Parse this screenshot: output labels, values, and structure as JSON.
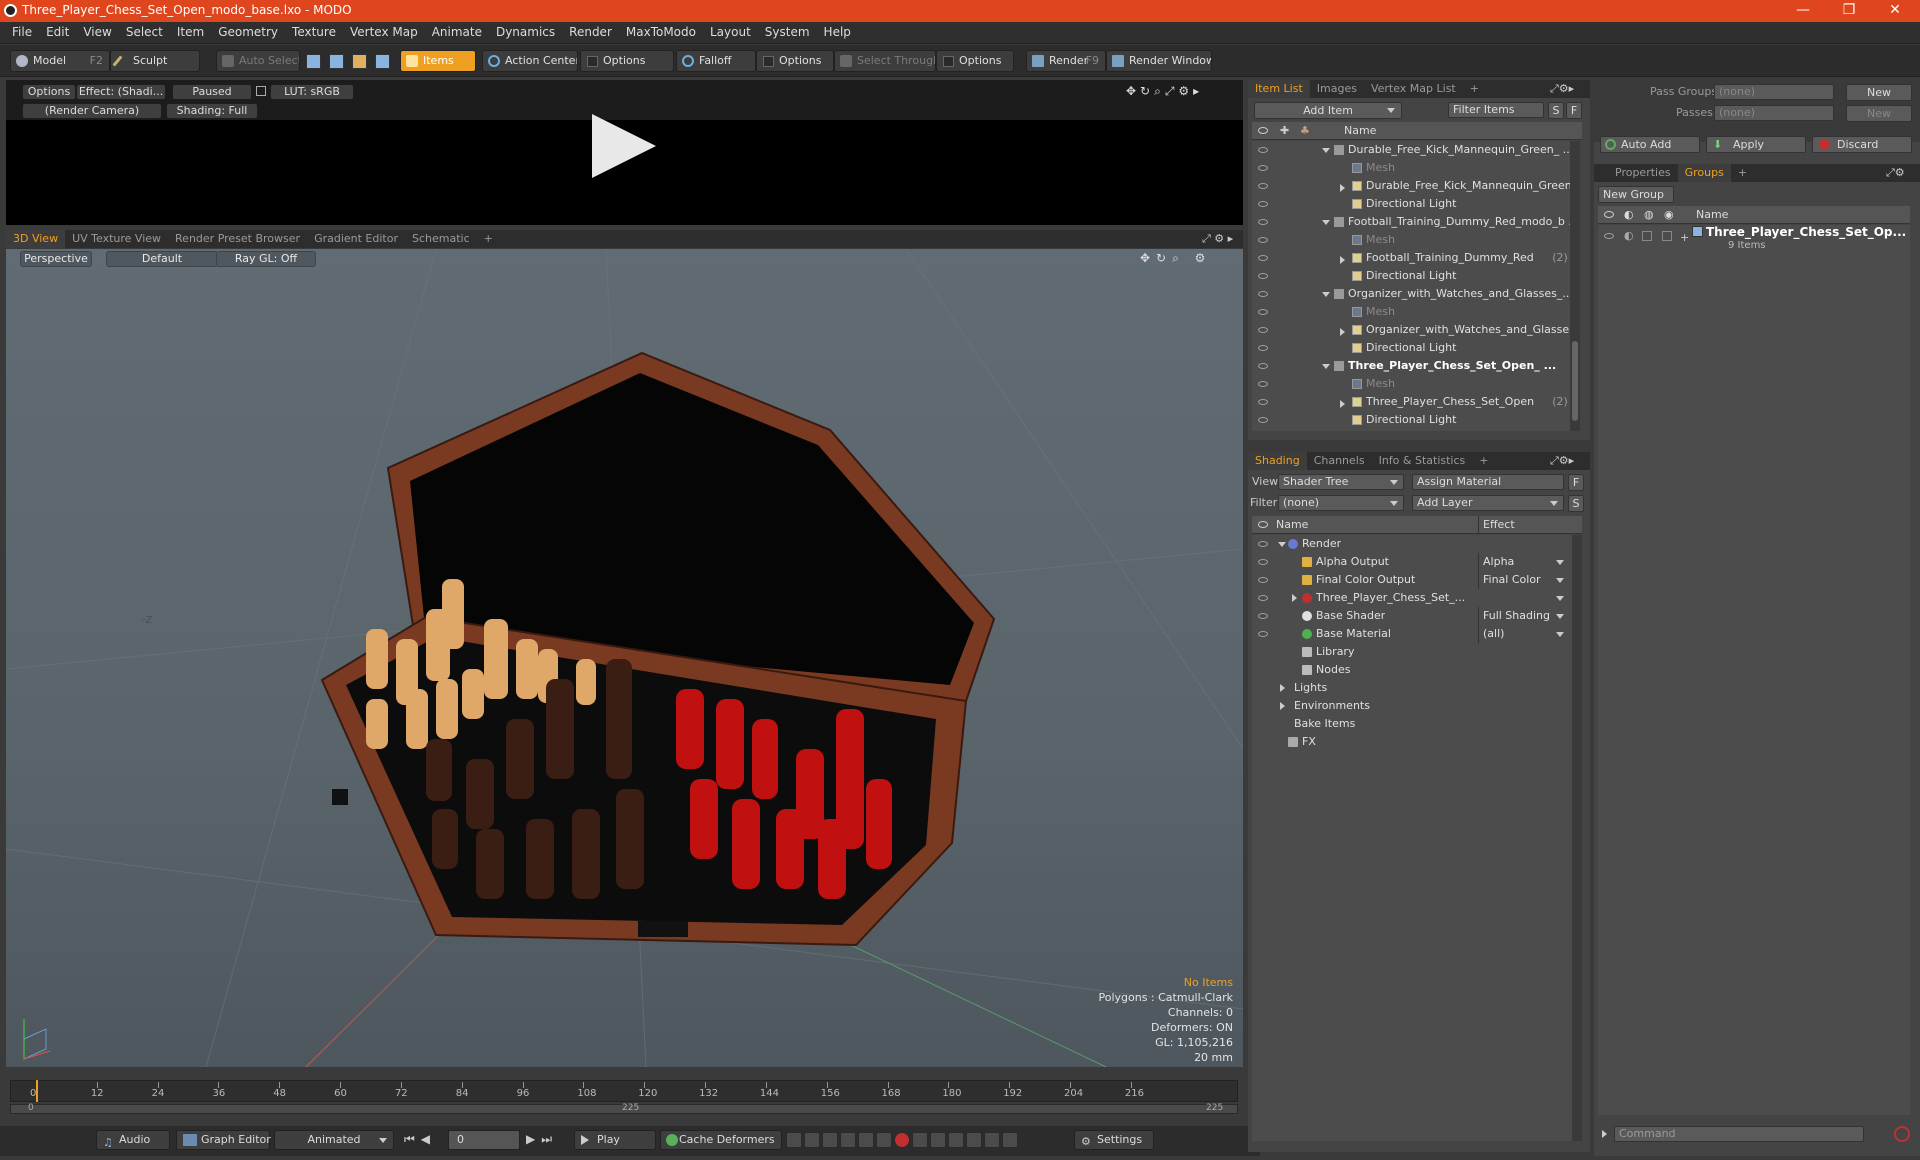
{
  "window": {
    "title": "Three_Player_Chess_Set_Open_modo_base.lxo - MODO",
    "minimize": "—",
    "restore": "❐",
    "close": "✕"
  },
  "menu": [
    "File",
    "Edit",
    "View",
    "Select",
    "Item",
    "Geometry",
    "Texture",
    "Vertex Map",
    "Animate",
    "Dynamics",
    "Render",
    "MaxToModo",
    "Layout",
    "System",
    "Help"
  ],
  "toolbar": {
    "model": "Model",
    "model_key": "F2",
    "sculpt": "Sculpt",
    "auto_select": "Auto Select",
    "items": "Items",
    "action_center": "Action Center",
    "options1": "Options",
    "falloff": "Falloff",
    "options2": "Options",
    "select_through": "Select Through",
    "options3": "Options",
    "render": "Render",
    "render_key": "F9",
    "render_window": "Render Window"
  },
  "preview": {
    "options": "Options",
    "effect": "Effect: (Shadi...",
    "paused": "Paused",
    "lut": "LUT: sRGB",
    "camera": "(Render Camera)",
    "shading": "Shading: Full"
  },
  "viewtabs": [
    "3D View",
    "UV Texture View",
    "Render Preset Browser",
    "Gradient Editor",
    "Schematic",
    "+"
  ],
  "viewport": {
    "perspective": "Perspective",
    "default": "Default",
    "raygl": "Ray GL: Off",
    "axis_label": "-Z",
    "stats": {
      "items": "No Items",
      "polygons": "Polygons : Catmull-Clark",
      "channels": "Channels: 0",
      "deformers": "Deformers: ON",
      "gl": "GL: 1,105,216",
      "scale": "20 mm"
    }
  },
  "timeline": {
    "ticks": [
      "0",
      "12",
      "24",
      "36",
      "48",
      "60",
      "72",
      "84",
      "96",
      "108",
      "120",
      "132",
      "144",
      "156",
      "168",
      "180",
      "192",
      "204",
      "216"
    ],
    "start": "0",
    "mid": "225",
    "end": "225"
  },
  "bottombar": {
    "audio": "Audio",
    "graph_editor": "Graph Editor",
    "animated": "Animated",
    "frame": "0",
    "play": "Play",
    "cache": "Cache Deformers",
    "settings": "Settings"
  },
  "itemlist": {
    "tabs": [
      "Item List",
      "Images",
      "Vertex Map List",
      "+"
    ],
    "add_item": "Add Item",
    "filter": "Filter Items",
    "s": "S",
    "f": "F",
    "col_name": "Name",
    "rows": [
      {
        "label": "Durable_Free_Kick_Mannequin_Green_ ...",
        "indent": 0,
        "style": "scene",
        "expand": "down"
      },
      {
        "label": "Mesh",
        "indent": 1,
        "style": "dim",
        "expand": ""
      },
      {
        "label": "Durable_Free_Kick_Mannequin_Green...",
        "indent": 1,
        "style": "",
        "expand": "right"
      },
      {
        "label": "Directional Light",
        "indent": 1,
        "style": "",
        "expand": ""
      },
      {
        "label": "Football_Training_Dummy_Red_modo_b ...",
        "indent": 0,
        "style": "scene",
        "expand": "down"
      },
      {
        "label": "Mesh",
        "indent": 1,
        "style": "dim",
        "expand": ""
      },
      {
        "label": "Football_Training_Dummy_Red",
        "count": "(2)",
        "indent": 1,
        "style": "",
        "expand": "right"
      },
      {
        "label": "Directional Light",
        "indent": 1,
        "style": "",
        "expand": ""
      },
      {
        "label": "Organizer_with_Watches_and_Glasses_...",
        "indent": 0,
        "style": "scene",
        "expand": "down"
      },
      {
        "label": "Mesh",
        "indent": 1,
        "style": "dim",
        "expand": ""
      },
      {
        "label": "Organizer_with_Watches_and_Glasse...",
        "indent": 1,
        "style": "",
        "expand": "right"
      },
      {
        "label": "Directional Light",
        "indent": 1,
        "style": "",
        "expand": ""
      },
      {
        "label": "Three_Player_Chess_Set_Open_ ...",
        "indent": 0,
        "style": "bold",
        "expand": "down"
      },
      {
        "label": "Mesh",
        "indent": 1,
        "style": "dim",
        "expand": ""
      },
      {
        "label": "Three_Player_Chess_Set_Open",
        "count": "(2)",
        "indent": 1,
        "style": "",
        "expand": "right"
      },
      {
        "label": "Directional Light",
        "indent": 1,
        "style": "",
        "expand": ""
      }
    ]
  },
  "shading": {
    "tabs": [
      "Shading",
      "Channels",
      "Info & Statistics",
      "+"
    ],
    "view_label": "View",
    "view_value": "Shader Tree",
    "assign": "Assign Material",
    "f": "F",
    "filter_label": "Filter",
    "filter_value": "(none)",
    "add_layer": "Add Layer",
    "s": "S",
    "col_name": "Name",
    "col_effect": "Effect",
    "rows": [
      {
        "label": "Render",
        "effect": "",
        "indent": 0,
        "icon": "render"
      },
      {
        "label": "Alpha Output",
        "effect": "Alpha",
        "indent": 1,
        "icon": "output"
      },
      {
        "label": "Final Color Output",
        "effect": "Final Color",
        "indent": 1,
        "icon": "output"
      },
      {
        "label": "Three_Player_Chess_Set_...",
        "effect": "",
        "indent": 1,
        "icon": "material"
      },
      {
        "label": "Base Shader",
        "effect": "Full Shading",
        "indent": 1,
        "icon": "shader"
      },
      {
        "label": "Base Material",
        "effect": "(all)",
        "indent": 1,
        "icon": "basemat"
      },
      {
        "label": "Library",
        "effect": "",
        "indent": 1,
        "icon": "folder"
      },
      {
        "label": "Nodes",
        "effect": "",
        "indent": 1,
        "icon": "folder"
      },
      {
        "label": "Lights",
        "effect": "",
        "indent": 0,
        "icon": "none"
      },
      {
        "label": "Environments",
        "effect": "",
        "indent": 0,
        "icon": "none"
      },
      {
        "label": "Bake Items",
        "effect": "",
        "indent": 0,
        "icon": "none"
      },
      {
        "label": "FX",
        "effect": "",
        "indent": 0,
        "icon": "fx"
      }
    ]
  },
  "rightpanel": {
    "pass_groups": "Pass Groups",
    "pass_value": "(none)",
    "new1": "New",
    "passes": "Passes",
    "passes_value": "(none)",
    "new2": "New",
    "auto_add": "Auto Add",
    "apply": "Apply",
    "discard": "Discard",
    "tabs": [
      "Properties",
      "Groups",
      "+"
    ],
    "new_group": "New Group",
    "col_name": "Name",
    "group_name": "Three_Player_Chess_Set_Op...",
    "group_count": "9 Items",
    "command": "Command"
  },
  "colors": {
    "accent": "#f0a020",
    "titlebar": "#e0461d"
  }
}
